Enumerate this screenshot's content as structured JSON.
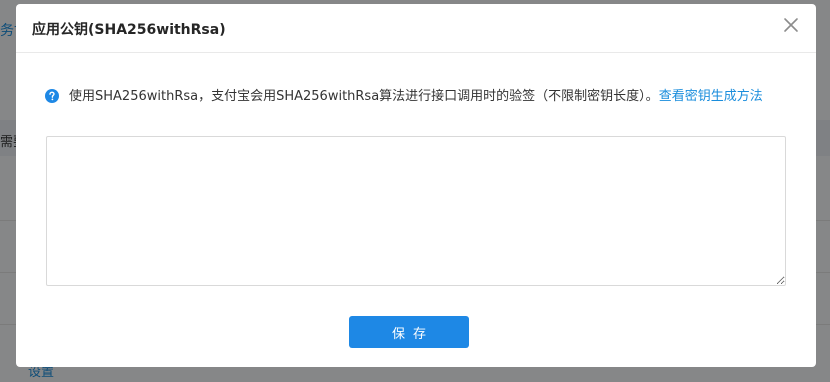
{
  "background": {
    "top_text": "务协",
    "bar_text": "需要",
    "bottom_text": "设置"
  },
  "modal": {
    "title": "应用公钥(SHA256withRsa)",
    "notice_text": "使用SHA256withRsa，支付宝会用SHA256withRsa算法进行接口调用时的验签（不限制密钥长度）。",
    "notice_link": "查看密钥生成方法",
    "textarea_value": "",
    "textarea_placeholder": "",
    "save_label": "保存"
  },
  "colors": {
    "accent": "#1e88e5",
    "link": "#1a8ddc"
  },
  "icons": {
    "help": "question-circle-icon",
    "close": "close-icon"
  }
}
